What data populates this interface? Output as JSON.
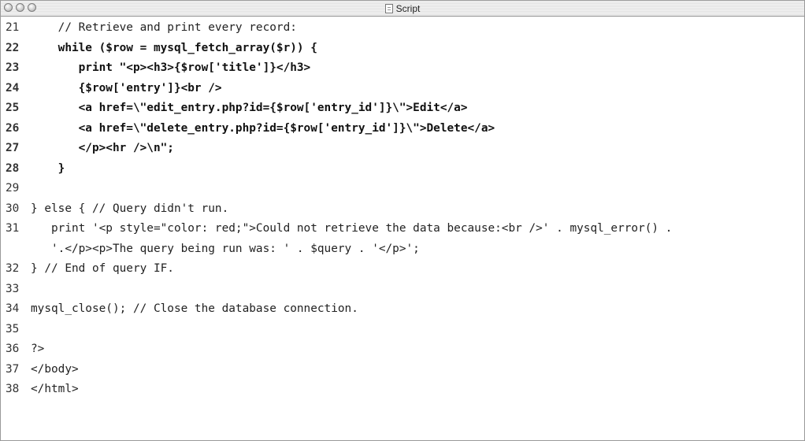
{
  "window": {
    "title": "Script"
  },
  "lines": [
    {
      "num": "21",
      "text": "    // Retrieve and print every record:",
      "bold": false
    },
    {
      "num": "22",
      "text": "    while ($row = mysql_fetch_array($r)) {",
      "bold": true
    },
    {
      "num": "23",
      "text": "       print \"<p><h3>{$row['title']}</h3>",
      "bold": true
    },
    {
      "num": "24",
      "text": "       {$row['entry']}<br />",
      "bold": true
    },
    {
      "num": "25",
      "text": "       <a href=\\\"edit_entry.php?id={$row['entry_id']}\\\">Edit</a>",
      "bold": true
    },
    {
      "num": "26",
      "text": "       <a href=\\\"delete_entry.php?id={$row['entry_id']}\\\">Delete</a>",
      "bold": true
    },
    {
      "num": "27",
      "text": "       </p><hr />\\n\";",
      "bold": true
    },
    {
      "num": "28",
      "text": "    }",
      "bold": true
    },
    {
      "num": "29",
      "text": "",
      "bold": false
    },
    {
      "num": "30",
      "text": "} else { // Query didn't run.",
      "bold": false
    },
    {
      "num": "31",
      "text": "   print '<p style=\"color: red;\">Could not retrieve the data because:<br />' . mysql_error() .",
      "bold": false,
      "continuation": "   '.</p><p>The query being run was: ' . $query . '</p>';"
    },
    {
      "num": "32",
      "text": "} // End of query IF.",
      "bold": false
    },
    {
      "num": "33",
      "text": "",
      "bold": false
    },
    {
      "num": "34",
      "text": "mysql_close(); // Close the database connection.",
      "bold": false
    },
    {
      "num": "35",
      "text": "",
      "bold": false
    },
    {
      "num": "36",
      "text": "?>",
      "bold": false
    },
    {
      "num": "37",
      "text": "</body>",
      "bold": false
    },
    {
      "num": "38",
      "text": "</html>",
      "bold": false
    }
  ]
}
